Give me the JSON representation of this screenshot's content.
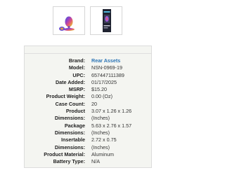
{
  "thumbnails": [
    {
      "name": "product-thumbnail-1",
      "icon": "rainbow-plug-product-icon"
    },
    {
      "name": "product-thumbnail-2",
      "icon": "packaged-product-box-icon"
    }
  ],
  "details": {
    "brand": {
      "label": "Brand:",
      "value": "Rear Assets"
    },
    "model": {
      "label": "Model:",
      "value": "NSN-0969-19"
    },
    "upc": {
      "label": "UPC:",
      "value": "657447111389"
    },
    "date_added": {
      "label": "Date Added:",
      "value": "01/17/2025"
    },
    "msrp": {
      "label": "MSRP:",
      "value": "$15.20"
    },
    "weight": {
      "label": "Product Weight:",
      "value": "0.00 (Oz)"
    },
    "case_count": {
      "label": "Case Count:",
      "value": "20"
    },
    "product_dims": {
      "label1": "Product",
      "label2": "Dimensions:",
      "value1": "3.07 x 1.26 x 1.26",
      "value2": "(Inches)"
    },
    "package_dims": {
      "label1": "Package",
      "label2": "Dimensions:",
      "value1": "5.63 x 2.76 x 1.57",
      "value2": "(Inches)"
    },
    "insertable_dims": {
      "label1": "Insertable",
      "label2": "Dimensions:",
      "value1": "2.72 x 0.75",
      "value2": "(Inches)"
    },
    "material": {
      "label": "Product Material:",
      "value": "Aluminum"
    },
    "battery": {
      "label": "Battery Type:",
      "value": "N/A"
    }
  },
  "colors": {
    "link": "#2b74b5",
    "card_bg": "#f4f5f1"
  }
}
